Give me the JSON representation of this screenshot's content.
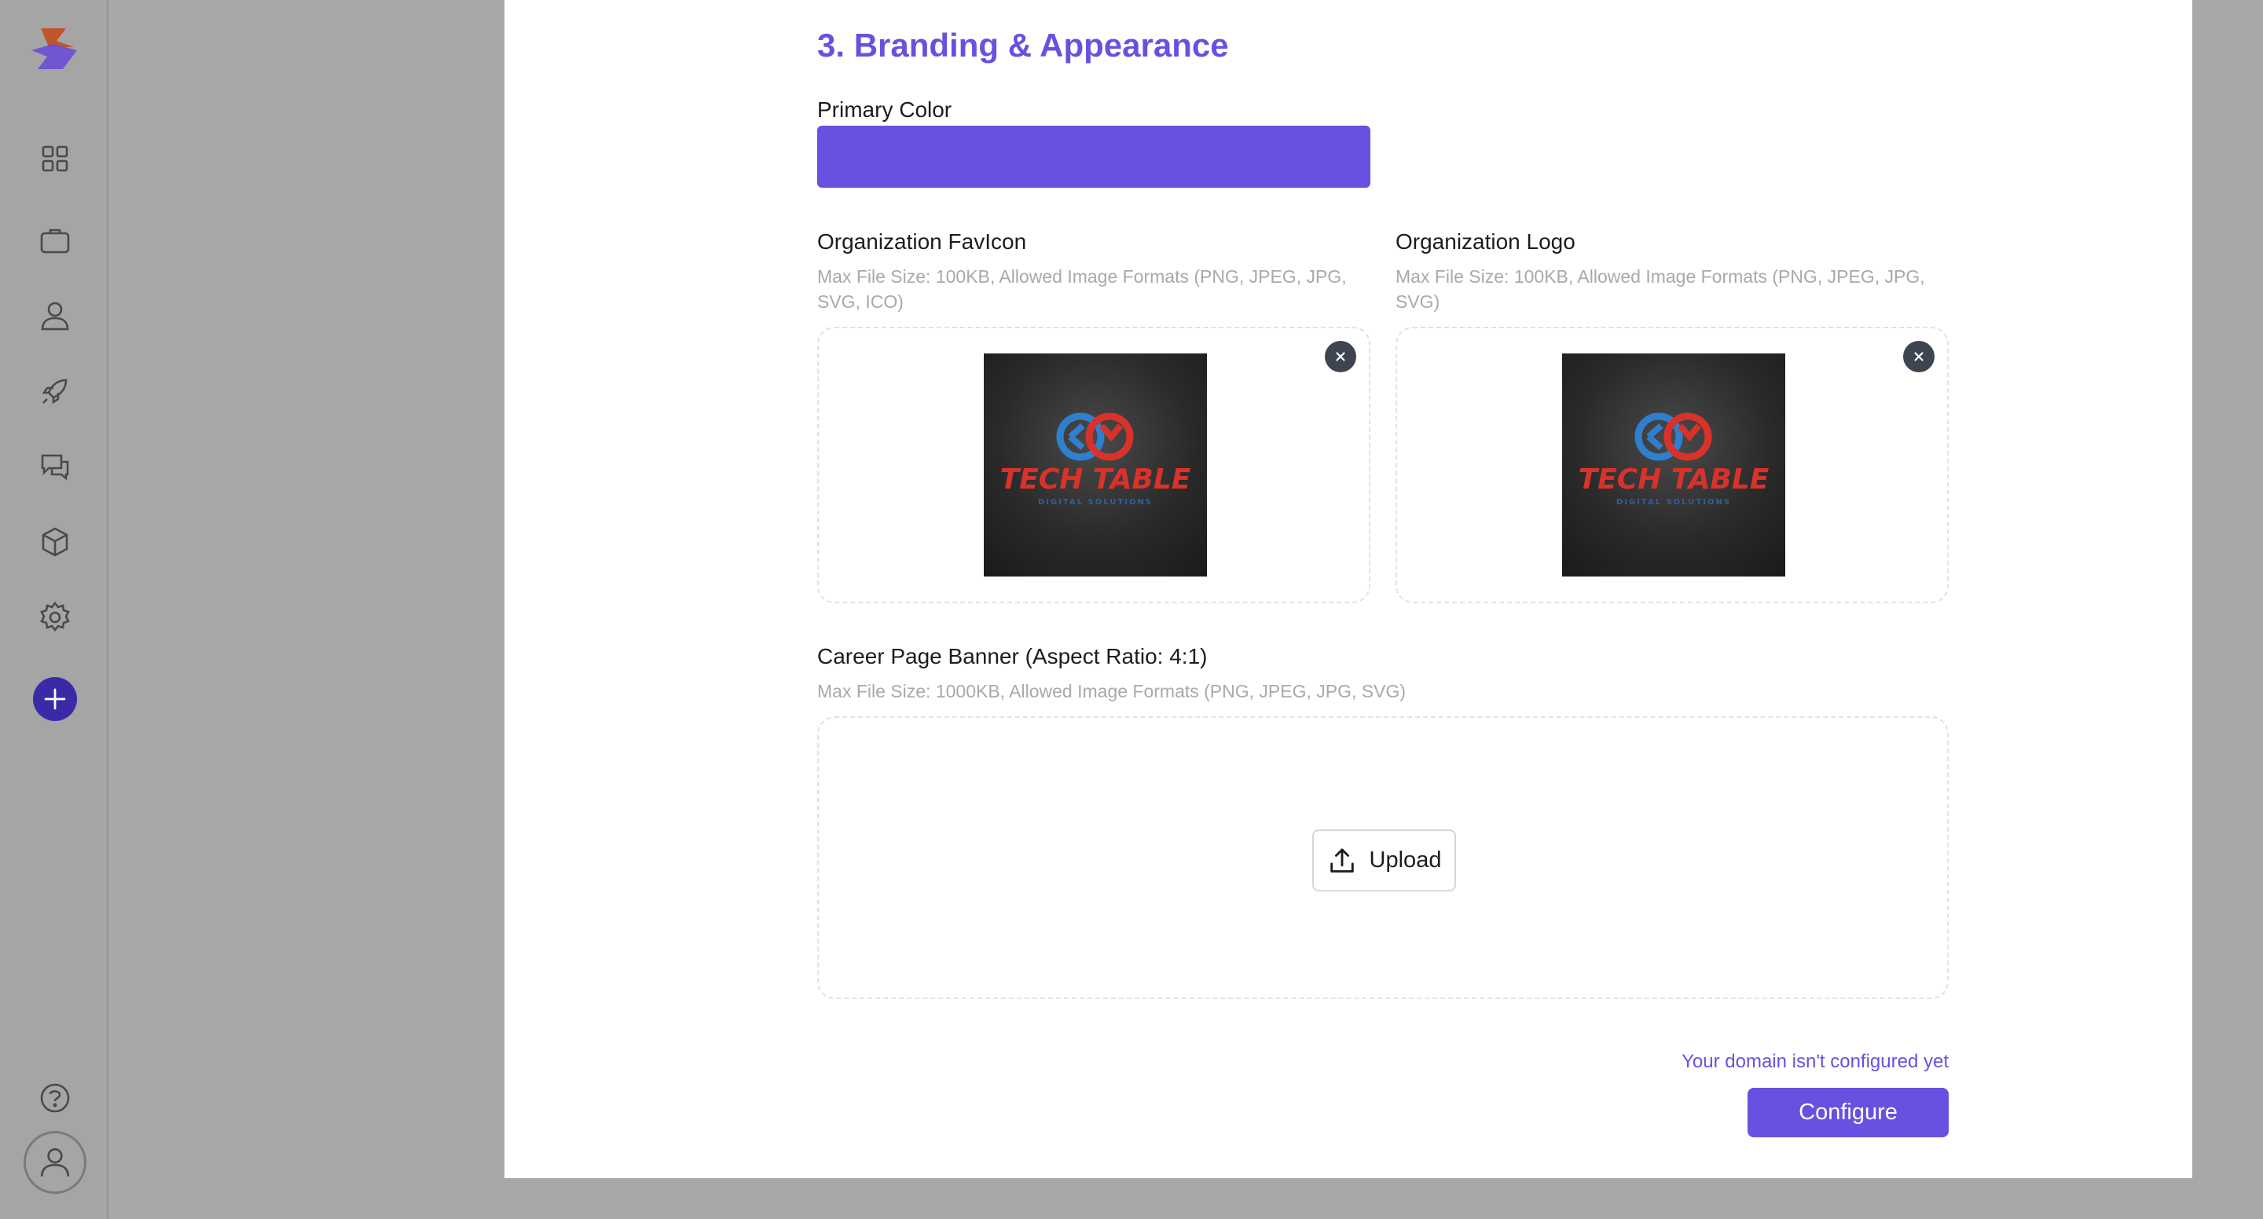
{
  "sidebar": {
    "icons": [
      "app-logo",
      "dashboard-icon",
      "briefcase-icon",
      "person-icon",
      "rocket-icon",
      "chat-icon",
      "cube-icon",
      "gear-icon",
      "add-icon",
      "help-icon",
      "avatar-icon"
    ],
    "accent": "#3b2aa8"
  },
  "section": {
    "title": "3. Branding & Appearance"
  },
  "primary_color": {
    "label": "Primary Color",
    "value": "#6a50e0"
  },
  "favicon": {
    "label": "Organization FavIcon",
    "hint": "Max File Size: 100KB, Allowed Image Formats (PNG, JPEG, JPG, SVG, ICO)"
  },
  "logo": {
    "label": "Organization Logo",
    "hint": "Max File Size: 100KB, Allowed Image Formats (PNG, JPEG, JPG, SVG)"
  },
  "preview_image": {
    "brand_line1": "TECH TABLE",
    "brand_line2": "DIGITAL SOLUTIONS"
  },
  "banner": {
    "label": "Career Page Banner (Aspect Ratio: 4:1)",
    "hint": "Max File Size: 1000KB, Allowed Image Formats (PNG, JPEG, JPG, SVG)",
    "upload_label": "Upload"
  },
  "footer": {
    "domain_note": "Your domain isn't configured yet",
    "configure_label": "Configure"
  }
}
